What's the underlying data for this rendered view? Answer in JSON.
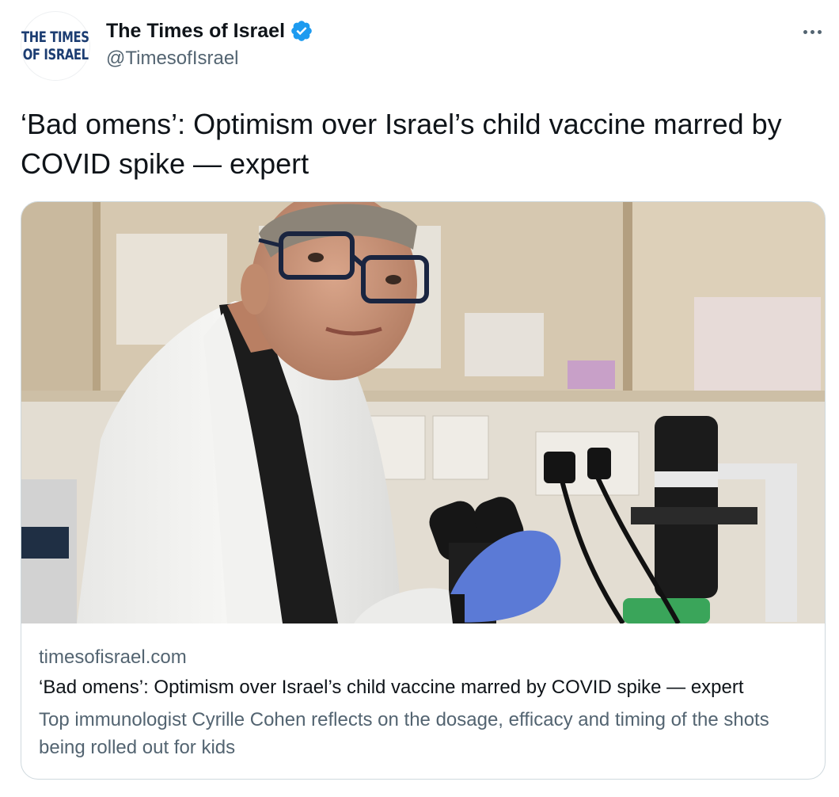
{
  "author": {
    "avatar_logo_line1": "THE TIMES",
    "avatar_logo_line2": "OF ISRAEL",
    "name": "The Times of Israel",
    "handle": "@TimesofIsrael",
    "verified": true,
    "verified_color": "#1d9bf0"
  },
  "more_icon": "more-horizontal-icon",
  "tweet": {
    "text": "‘Bad omens’: Optimism over Israel’s child vaccine marred by COVID spike — expert"
  },
  "card": {
    "image": "photo of scientist in white lab coat with microscope in laboratory",
    "domain": "timesofisrael.com",
    "title": "‘Bad omens’: Optimism over Israel’s child vaccine marred by COVID spike — expert",
    "description": "Top immunologist Cyrille Cohen reflects on the dosage, efficacy and timing of the shots being rolled out for kids"
  },
  "colors": {
    "text_primary": "#0f1419",
    "text_secondary": "#536471",
    "border": "#cfd9de",
    "logo": "#1c3d72"
  }
}
